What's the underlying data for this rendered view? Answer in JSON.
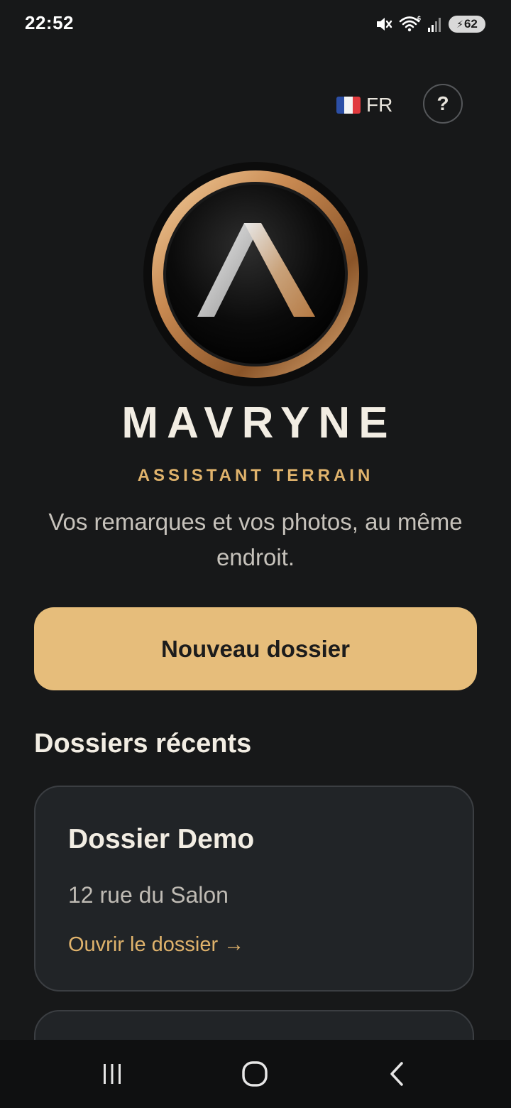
{
  "status_bar": {
    "time": "22:52",
    "battery_level": "62",
    "icons": [
      "mute-icon",
      "wifi-icon",
      "signal-icon",
      "battery-charging-icon"
    ]
  },
  "header": {
    "language_code": "FR",
    "language_flag": "france-flag-icon",
    "help_label": "?"
  },
  "brand": {
    "title": "MAVRYNE",
    "subtitle": "ASSISTANT TERRAIN",
    "tagline": "Vos remarques et vos photos, au même endroit."
  },
  "actions": {
    "new_folder_label": "Nouveau dossier"
  },
  "recent": {
    "section_title": "Dossiers récents",
    "items": [
      {
        "name": "Dossier Demo",
        "address": "12 rue du Salon",
        "link_label": "Ouvrir le dossier →"
      }
    ]
  },
  "nav": {
    "icons": [
      "recents-icon",
      "home-icon",
      "back-icon"
    ]
  },
  "colors": {
    "background": "#171819",
    "accent": "#e6bd7b",
    "accent_text": "#e0b36c",
    "card_bg": "#212427"
  }
}
